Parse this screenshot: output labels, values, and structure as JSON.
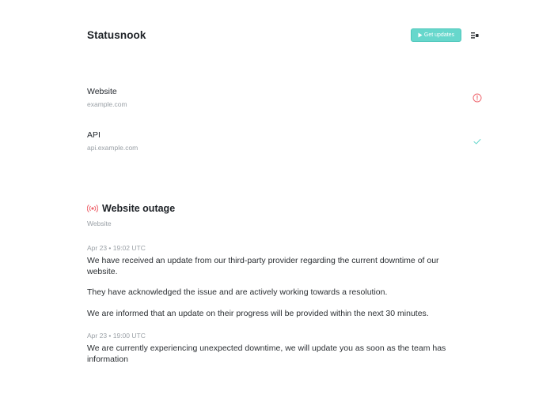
{
  "header": {
    "brand": "Statusnook",
    "get_updates_label": "Get updates"
  },
  "services": [
    {
      "name": "Website",
      "host": "example.com",
      "status": "down",
      "status_color": "#ef6b73"
    },
    {
      "name": "API",
      "host": "api.example.com",
      "status": "operational",
      "status_color": "#67d7cc"
    }
  ],
  "incident": {
    "title": "Website outage",
    "affected": "Website",
    "live_color": "#ef6b73",
    "updates": [
      {
        "timestamp": "Apr 23 • 19:02 UTC",
        "paragraphs": [
          "We have received an update from our third-party provider regarding the current downtime of our website.",
          "They have acknowledged the issue and are actively working towards a resolution.",
          "We are informed that an update on their progress will be provided within the next 30 minutes."
        ]
      },
      {
        "timestamp": "Apr 23 • 19:00 UTC",
        "paragraphs": [
          "We are currently experiencing unexpected downtime, we will update you as soon as the team has information"
        ]
      }
    ]
  }
}
